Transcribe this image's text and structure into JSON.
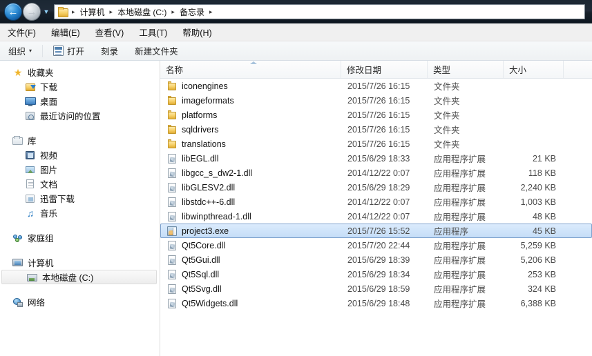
{
  "titlebar": {
    "back_icon": "back-arrow-icon",
    "forward_icon": "forward-arrow-icon",
    "history_icon": "chevron-down-icon",
    "address_folder_icon": "folder-icon",
    "breadcrumbs": [
      "计算机",
      "本地磁盘 (C:)",
      "备忘录"
    ],
    "separator": "▸"
  },
  "menubar": {
    "items": [
      {
        "label": "文件(F)",
        "name": "menu-file"
      },
      {
        "label": "编辑(E)",
        "name": "menu-edit"
      },
      {
        "label": "查看(V)",
        "name": "menu-view"
      },
      {
        "label": "工具(T)",
        "name": "menu-tools"
      },
      {
        "label": "帮助(H)",
        "name": "menu-help"
      }
    ]
  },
  "toolbar": {
    "organize_label": "组织",
    "organize_caret": "▾",
    "open_label": "打开",
    "open_icon": "open-file-icon",
    "burn_label": "刻录",
    "newfolder_label": "新建文件夹"
  },
  "sidebar": {
    "sections": [
      {
        "header": {
          "label": "收藏夹",
          "icon": "star-icon",
          "name": "sidebar-section-favorites"
        },
        "items": [
          {
            "label": "下载",
            "icon": "downloads-icon",
            "name": "sidebar-item-downloads"
          },
          {
            "label": "桌面",
            "icon": "desktop-icon",
            "name": "sidebar-item-desktop"
          },
          {
            "label": "最近访问的位置",
            "icon": "recent-places-icon",
            "name": "sidebar-item-recent"
          }
        ]
      },
      {
        "header": {
          "label": "库",
          "icon": "library-icon",
          "name": "sidebar-section-libraries"
        },
        "items": [
          {
            "label": "视频",
            "icon": "video-icon",
            "name": "sidebar-item-videos"
          },
          {
            "label": "图片",
            "icon": "pictures-icon",
            "name": "sidebar-item-pictures"
          },
          {
            "label": "文档",
            "icon": "documents-icon",
            "name": "sidebar-item-documents"
          },
          {
            "label": "迅雷下载",
            "icon": "xunlei-download-icon",
            "name": "sidebar-item-xunlei"
          },
          {
            "label": "音乐",
            "icon": "music-note-icon",
            "name": "sidebar-item-music"
          }
        ]
      },
      {
        "header": {
          "label": "家庭组",
          "icon": "homegroup-icon",
          "name": "sidebar-section-homegroup"
        },
        "items": []
      },
      {
        "header": {
          "label": "计算机",
          "icon": "computer-icon",
          "name": "sidebar-section-computer"
        },
        "items": [
          {
            "label": "本地磁盘 (C:)",
            "icon": "hard-drive-icon",
            "name": "sidebar-item-local-disk-c",
            "selected": true
          }
        ]
      },
      {
        "header": {
          "label": "网络",
          "icon": "network-icon",
          "name": "sidebar-section-network"
        },
        "items": []
      }
    ]
  },
  "filelist": {
    "columns": [
      {
        "label": "名称",
        "name": "column-header-name",
        "sorted": "asc"
      },
      {
        "label": "修改日期",
        "name": "column-header-date-modified"
      },
      {
        "label": "类型",
        "name": "column-header-type"
      },
      {
        "label": "大小",
        "name": "column-header-size"
      }
    ],
    "rows": [
      {
        "name": "iconengines",
        "date": "2015/7/26 16:15",
        "type": "文件夹",
        "size": "",
        "icon": "folder-icon",
        "selected": false
      },
      {
        "name": "imageformats",
        "date": "2015/7/26 16:15",
        "type": "文件夹",
        "size": "",
        "icon": "folder-icon",
        "selected": false
      },
      {
        "name": "platforms",
        "date": "2015/7/26 16:15",
        "type": "文件夹",
        "size": "",
        "icon": "folder-icon",
        "selected": false
      },
      {
        "name": "sqldrivers",
        "date": "2015/7/26 16:15",
        "type": "文件夹",
        "size": "",
        "icon": "folder-icon",
        "selected": false
      },
      {
        "name": "translations",
        "date": "2015/7/26 16:15",
        "type": "文件夹",
        "size": "",
        "icon": "folder-icon",
        "selected": false
      },
      {
        "name": "libEGL.dll",
        "date": "2015/6/29 18:33",
        "type": "应用程序扩展",
        "size": "21 KB",
        "icon": "dll-icon",
        "selected": false
      },
      {
        "name": "libgcc_s_dw2-1.dll",
        "date": "2014/12/22 0:07",
        "type": "应用程序扩展",
        "size": "118 KB",
        "icon": "dll-icon",
        "selected": false
      },
      {
        "name": "libGLESV2.dll",
        "date": "2015/6/29 18:29",
        "type": "应用程序扩展",
        "size": "2,240 KB",
        "icon": "dll-icon",
        "selected": false
      },
      {
        "name": "libstdc++-6.dll",
        "date": "2014/12/22 0:07",
        "type": "应用程序扩展",
        "size": "1,003 KB",
        "icon": "dll-icon",
        "selected": false
      },
      {
        "name": "libwinpthread-1.dll",
        "date": "2014/12/22 0:07",
        "type": "应用程序扩展",
        "size": "48 KB",
        "icon": "dll-icon",
        "selected": false
      },
      {
        "name": "project3.exe",
        "date": "2015/7/26 15:52",
        "type": "应用程序",
        "size": "45 KB",
        "icon": "exe-icon",
        "selected": true
      },
      {
        "name": "Qt5Core.dll",
        "date": "2015/7/20 22:44",
        "type": "应用程序扩展",
        "size": "5,259 KB",
        "icon": "dll-icon",
        "selected": false
      },
      {
        "name": "Qt5Gui.dll",
        "date": "2015/6/29 18:39",
        "type": "应用程序扩展",
        "size": "5,206 KB",
        "icon": "dll-icon",
        "selected": false
      },
      {
        "name": "Qt5Sql.dll",
        "date": "2015/6/29 18:34",
        "type": "应用程序扩展",
        "size": "253 KB",
        "icon": "dll-icon",
        "selected": false
      },
      {
        "name": "Qt5Svg.dll",
        "date": "2015/6/29 18:59",
        "type": "应用程序扩展",
        "size": "324 KB",
        "icon": "dll-icon",
        "selected": false
      },
      {
        "name": "Qt5Widgets.dll",
        "date": "2015/6/29 18:48",
        "type": "应用程序扩展",
        "size": "6,388 KB",
        "icon": "dll-icon",
        "selected": false
      }
    ]
  },
  "colors": {
    "selection_fill": "#cfe4fa",
    "selection_border": "#7da2ce",
    "titlebar": "#1b2733",
    "folder_gold": "#f0c040"
  }
}
